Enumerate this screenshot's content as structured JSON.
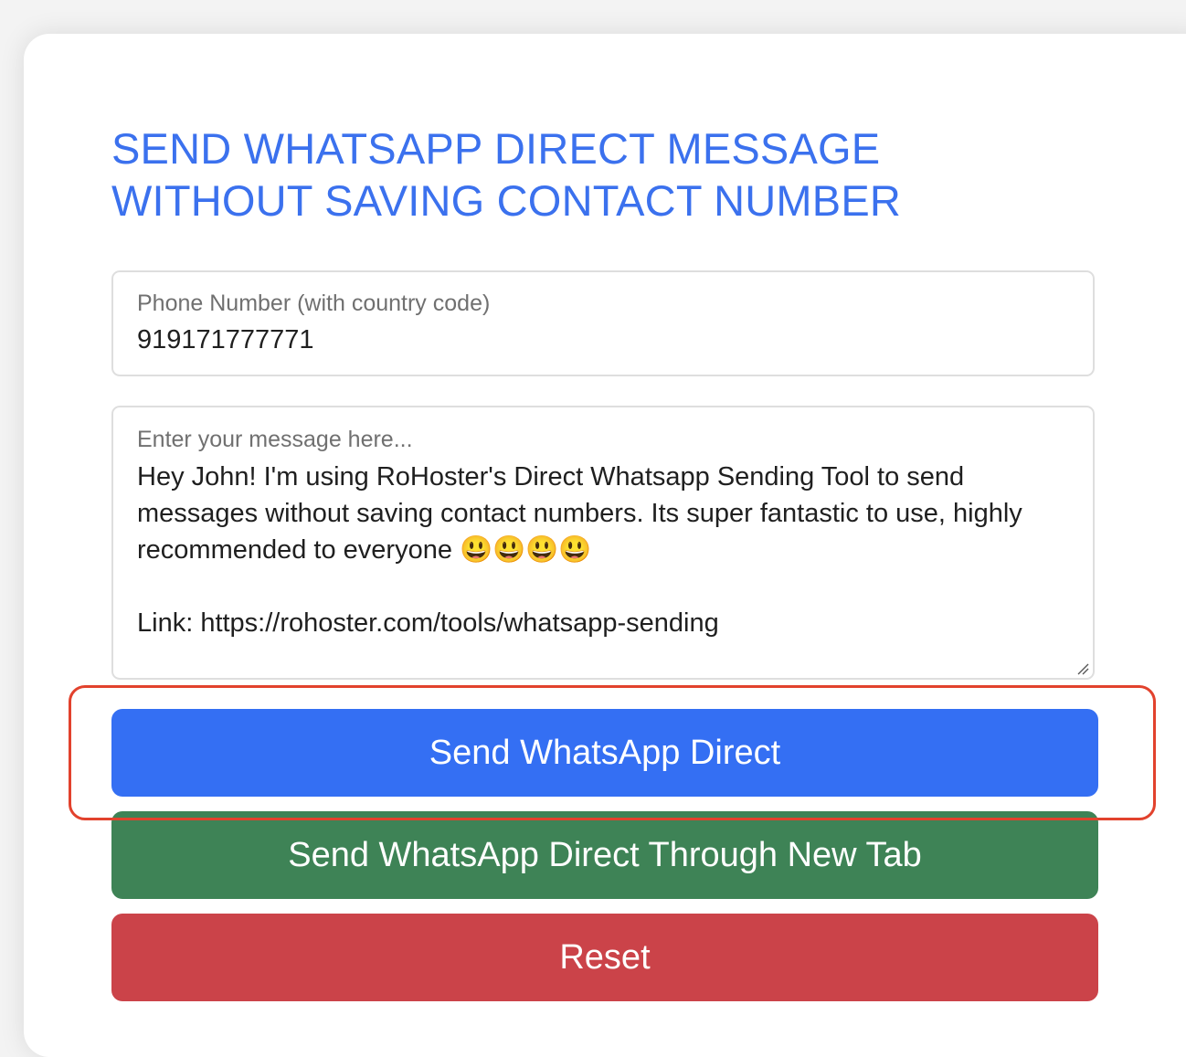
{
  "form": {
    "title": "SEND WHATSAPP DIRECT MESSAGE WITHOUT SAVING CONTACT NUMBER",
    "phone_label": "Phone Number (with country code)",
    "phone_value": "919171777771",
    "message_label": "Enter your message here...",
    "message_value": "Hey John! I'm using RoHoster's Direct Whatsapp Sending Tool to send messages without saving contact numbers. Its super fantastic to use, highly recommended to everyone 😃😃😃😃\n\nLink: https://rohoster.com/tools/whatsapp-sending"
  },
  "buttons": {
    "send_direct": "Send WhatsApp Direct",
    "send_new_tab": "Send WhatsApp Direct Through New Tab",
    "reset": "Reset"
  },
  "colors": {
    "title": "#3b71ee",
    "send_direct": "#346ff3",
    "send_new_tab": "#3e8356",
    "reset": "#cb4349",
    "highlight": "#e2422d"
  }
}
